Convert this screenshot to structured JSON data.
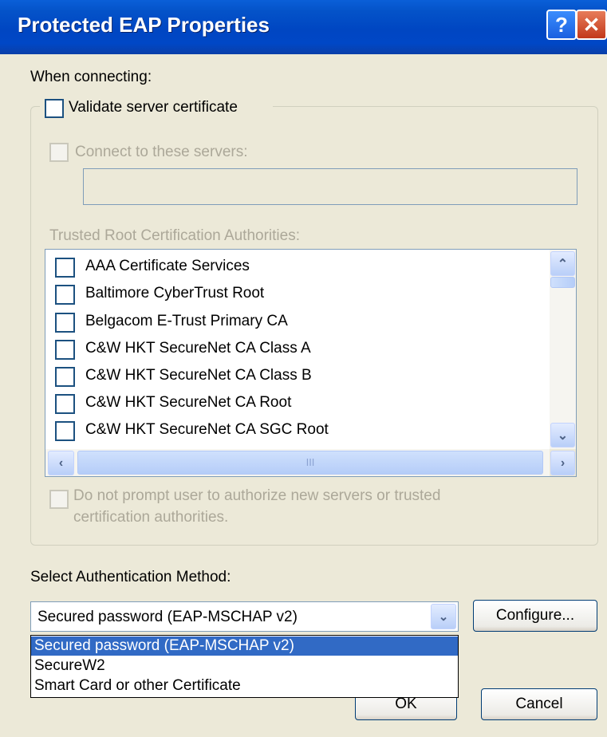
{
  "window": {
    "title": "Protected EAP Properties",
    "help_glyph": "?",
    "close_glyph": "✕"
  },
  "labels": {
    "when_connecting": "When connecting:",
    "validate_cert": "Validate server certificate",
    "connect_servers": "Connect to these servers:",
    "trusted_root": "Trusted Root Certification Authorities:",
    "no_prompt_1": "Do not prompt user to authorize new servers or trusted",
    "no_prompt_2": "certification authorities.",
    "select_auth": "Select Authentication Method:"
  },
  "certificates": [
    "AAA Certificate Services",
    "Baltimore CyberTrust Root",
    "Belgacom E-Trust Primary CA",
    "C&W HKT SecureNet CA Class A",
    "C&W HKT SecureNet CA Class B",
    "C&W HKT SecureNet CA Root",
    "C&W HKT SecureNet CA SGC Root"
  ],
  "auth_method": {
    "selected": "Secured password (EAP-MSCHAP v2)",
    "options": [
      "Secured password (EAP-MSCHAP v2)",
      "SecureW2",
      "Smart Card or other Certificate"
    ]
  },
  "buttons": {
    "configure": "Configure...",
    "ok": "OK",
    "cancel": "Cancel"
  },
  "scroll_glyphs": {
    "up": "⌃",
    "down": "⌄",
    "left": "‹",
    "right": "›",
    "grip": "III"
  },
  "colors": {
    "titlebar": "#0046c2",
    "selection": "#316ac5",
    "dialog_bg": "#ece9d8"
  }
}
